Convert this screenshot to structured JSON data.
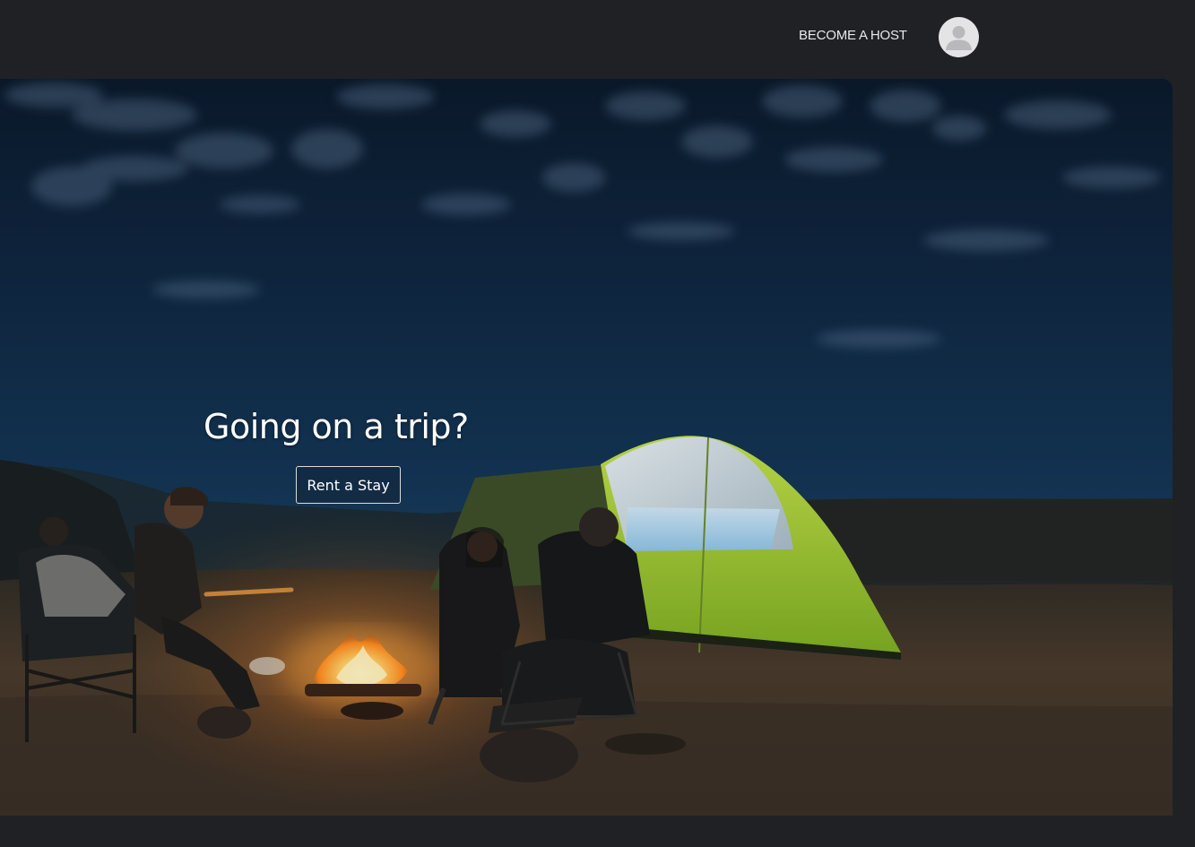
{
  "header": {
    "become_host_label": "BECOME A HOST",
    "avatar_icon": "user-avatar-icon"
  },
  "hero": {
    "title": "Going on a trip?",
    "cta_label": "Rent a Stay",
    "image_subject": "night camping scene with campfire and lit tent"
  },
  "colors": {
    "background": "#1f2125",
    "sky": "#12304f",
    "tent_green": "#a9d43a",
    "fire": "#ffb43c",
    "text": "#ffffff"
  }
}
